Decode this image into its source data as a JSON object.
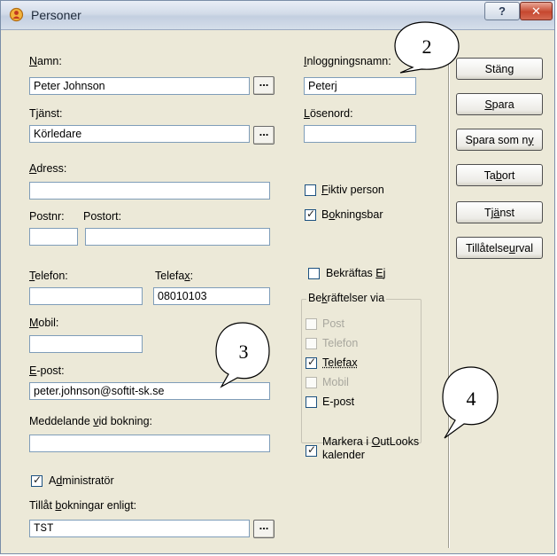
{
  "window": {
    "title": "Personer",
    "help_label": "?",
    "close_label": "✕"
  },
  "left": {
    "namn_label_u": "N",
    "namn_label_rest": "amn:",
    "namn_value": "Peter Johnson",
    "tjanst_label": "Tjänst:",
    "tjanst_value": "Körledare",
    "adress_label_u": "A",
    "adress_label_rest": "dress:",
    "adress_value": "",
    "postnr_label": "Postnr:",
    "postort_label": "Postort:",
    "postnr_value": "",
    "postort_value": "",
    "telefon_label_u": "T",
    "telefon_label_rest": "elefon:",
    "telefon_value": "",
    "telefax_label_a": "Telefa",
    "telefax_label_u": "x",
    "telefax_label_b": ":",
    "telefax_value": "08010103",
    "mobil_label_u": "M",
    "mobil_label_rest": "obil:",
    "mobil_value": "",
    "epost_label_u": "E",
    "epost_label_rest": "-post:",
    "epost_value": "peter.johnson@softit-sk.se",
    "meddelande_label_a": "Meddelande ",
    "meddelande_label_u": "v",
    "meddelande_label_b": "id bokning:",
    "meddelande_value": "",
    "admin_label_a": "A",
    "admin_label_u": "d",
    "admin_label_b": "ministratör",
    "admin_checked": true,
    "tillat_label_a": "Tillåt ",
    "tillat_label_u": "b",
    "tillat_label_b": "okningar enligt:",
    "tillat_value": "TST",
    "dots": "..."
  },
  "middle": {
    "inlogg_label_u": "I",
    "inlogg_label_rest": "nloggningsnamn:",
    "inlogg_value": "Peterj",
    "losen_label_u": "L",
    "losen_label_rest": "ösenord:",
    "losen_value": "",
    "fiktiv_label_u": "F",
    "fiktiv_label_rest": "iktiv person",
    "fiktiv_checked": false,
    "bokningsbar_label_a": "B",
    "bokningsbar_label_u": "o",
    "bokningsbar_label_b": "kningsbar",
    "bokningsbar_checked": true,
    "bekraftas_label_a": "Bekräftas ",
    "bekraftas_label_u": "E",
    "bekraftas_label_b": "j",
    "bekraftas_checked": false,
    "group_title_a": "Be",
    "group_title_u": "k",
    "group_title_b": "räftelser via",
    "via": [
      {
        "label": "Post",
        "checked": false,
        "disabled": true
      },
      {
        "label": "Telefon",
        "checked": false,
        "disabled": true
      },
      {
        "label": "Telefax",
        "checked": true,
        "disabled": false
      },
      {
        "label": "Mobil",
        "checked": false,
        "disabled": true
      },
      {
        "label": "E-post",
        "checked": false,
        "disabled": false
      }
    ],
    "outlook_label_a": "Markera i ",
    "outlook_label_u": "O",
    "outlook_label_b": "utLooks",
    "outlook_label_line2": "kalender",
    "outlook_checked": true
  },
  "buttons": {
    "stang": "Stäng",
    "spara_u": "S",
    "spara_rest": "para",
    "spara_som_ny_a": "Spara som n",
    "spara_som_ny_u": "y",
    "ta_bort_a": "Ta ",
    "ta_bort_u": "b",
    "ta_bort_b": "ort",
    "tjanst_a": "Tj",
    "tjanst_u": "ä",
    "tjanst_b": "nst",
    "tillatelse_a": "Tillåtelse ",
    "tillatelse_u": "u",
    "tillatelse_b": "rval"
  },
  "callouts": [
    "2",
    "3",
    "4"
  ],
  "colors": {
    "window_bg": "#ece9d8",
    "field_border": "#7f9db9",
    "close_red": "#c6482f"
  }
}
